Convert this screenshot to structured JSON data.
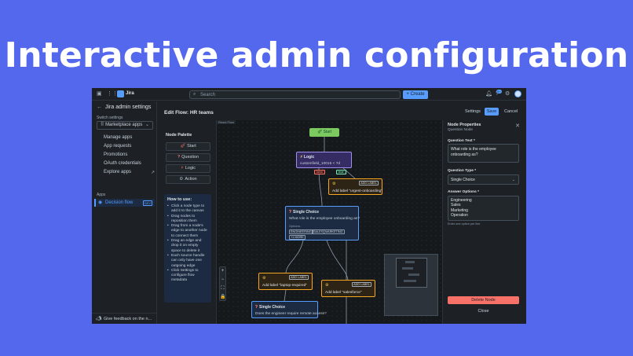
{
  "headline": "Interactive admin configuration",
  "topbar": {
    "product_name": "Jira",
    "search_placeholder": "Search",
    "create_label": "Create",
    "notification_badge": "9+"
  },
  "sidebar": {
    "title": "Jira admin settings",
    "switch_label": "Switch settings",
    "selected_setting": "Marketplace apps",
    "items": [
      {
        "label": "Manage apps"
      },
      {
        "label": "App requests"
      },
      {
        "label": "Promotions"
      },
      {
        "label": "OAuth credentials"
      },
      {
        "label": "Explore apps"
      }
    ],
    "apps_section": "Apps",
    "active_app": {
      "label": "Decision flow",
      "tag": "DEV"
    },
    "feedback": "Give feedback on the n..."
  },
  "main": {
    "title": "Edit Flow: HR teams",
    "settings_label": "Settings",
    "save_label": "Save",
    "cancel_label": "Cancel"
  },
  "palette": {
    "title": "Node Palette",
    "items": [
      {
        "label": "Start",
        "icon": "rocket-icon"
      },
      {
        "label": "Question",
        "icon": "question-icon"
      },
      {
        "label": "Logic",
        "icon": "logic-icon"
      },
      {
        "label": "Action",
        "icon": "gear-icon"
      }
    ],
    "howto_title": "How to use:",
    "howto_items": [
      "Click a node type to add it to the canvas",
      "Drag nodes to reposition them",
      "Drag from a node's edge to another node to connect them",
      "Drag an edge and drop it on empty space to delete it",
      "Each source handle can only have one outgoing edge",
      "Click Settings to configure flow metadata"
    ]
  },
  "canvas": {
    "label": "React Flow",
    "start_node": "Start",
    "logic_node": {
      "title": "Logic",
      "expr": "customfield_10015 < 7d",
      "false_label": "false",
      "true_label": "true"
    },
    "action_nodes": [
      {
        "label": "Add label \"urgent-onboarding\"",
        "button": "ADD LABEL"
      },
      {
        "label": "Add label \"laptop-required\"",
        "button": "ADD LABEL"
      },
      {
        "label": "Add label \"salesforce\"",
        "button": "ADD LABEL"
      }
    ],
    "choice_nodes": [
      {
        "title": "Single Choice",
        "question": "What role is the employee onboarding as?",
        "options_label": "Options:",
        "options": [
          "ENGINEERING",
          "SALES",
          "MARKETING"
        ],
        "more": "+1 MORE"
      },
      {
        "title": "Single Choice",
        "question": "Does the engineer require remote access?"
      }
    ],
    "zoom": [
      "+",
      "−",
      "⛶",
      "🔒"
    ]
  },
  "properties": {
    "title": "Node Properties",
    "subtitle": "Question Node",
    "question_text_label": "Question Text *",
    "question_text_value": "What role is the employee onboarding as?",
    "question_type_label": "Question Type *",
    "question_type_value": "Single Choice",
    "answer_options_label": "Answer Options *",
    "answer_options": [
      "Engineering",
      "Sales",
      "Marketing",
      "Operation"
    ],
    "answer_hint": "Enter one option per line",
    "delete_label": "Delete Node",
    "close_label": "Close"
  }
}
